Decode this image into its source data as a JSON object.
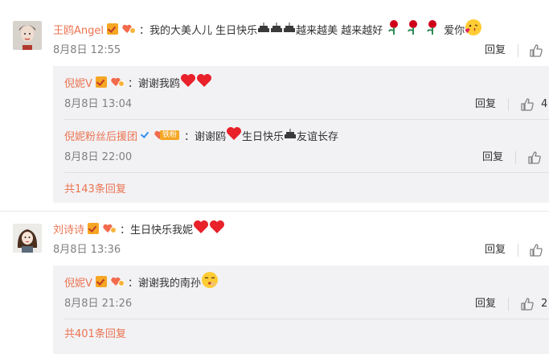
{
  "comments": [
    {
      "username": "王鸥Angel",
      "text": "：我的大美人儿 生日快乐",
      "text_tail": "越来越美 越来越好",
      "text_end": "爱你",
      "time": "8月8日 12:55",
      "reply_label": "回复",
      "icons": [
        "verified-icon",
        "fan-badge-icon",
        "cake-emoji",
        "rose-emoji",
        "kiss-face-emoji",
        "like-icon"
      ],
      "replies": [
        {
          "username": "倪妮V",
          "text": "：谢谢我鸥",
          "time": "8月8日 13:04",
          "reply_label": "回复",
          "like_count": "4",
          "icons": [
            "verified-icon",
            "fan-badge-icon",
            "red-heart-emoji",
            "like-icon"
          ]
        },
        {
          "username": "倪妮粉丝后援团",
          "badge_text": "铁粉",
          "text": "：谢谢鸥",
          "text_mid": "生日快乐",
          "text_end": "友谊长存",
          "time": "8月8日 22:00",
          "reply_label": "回复",
          "icons": [
            "blue-verified-icon",
            "iron-fan-badge",
            "red-heart-emoji",
            "cake-emoji",
            "like-icon"
          ]
        }
      ],
      "more_replies": "共143条回复"
    },
    {
      "username": "刘诗诗",
      "text": "：生日快乐我妮",
      "time": "8月8日 13:36",
      "reply_label": "回复",
      "icons": [
        "verified-icon",
        "fan-badge-icon",
        "red-heart-emoji",
        "like-icon"
      ],
      "replies": [
        {
          "username": "倪妮V",
          "text": "：谢谢我的南孙",
          "time": "8月8日 21:26",
          "reply_label": "回复",
          "like_count": "2",
          "icons": [
            "verified-icon",
            "fan-badge-icon",
            "shy-face-emoji",
            "like-icon"
          ]
        }
      ],
      "more_replies": "共401条回复"
    }
  ],
  "colors": {
    "username": "#eb7350",
    "timestamp": "#808080",
    "reply_box_bg": "#f2f2f5",
    "verified_gold": "#f5a623",
    "verified_blue": "#2f8ff0"
  }
}
